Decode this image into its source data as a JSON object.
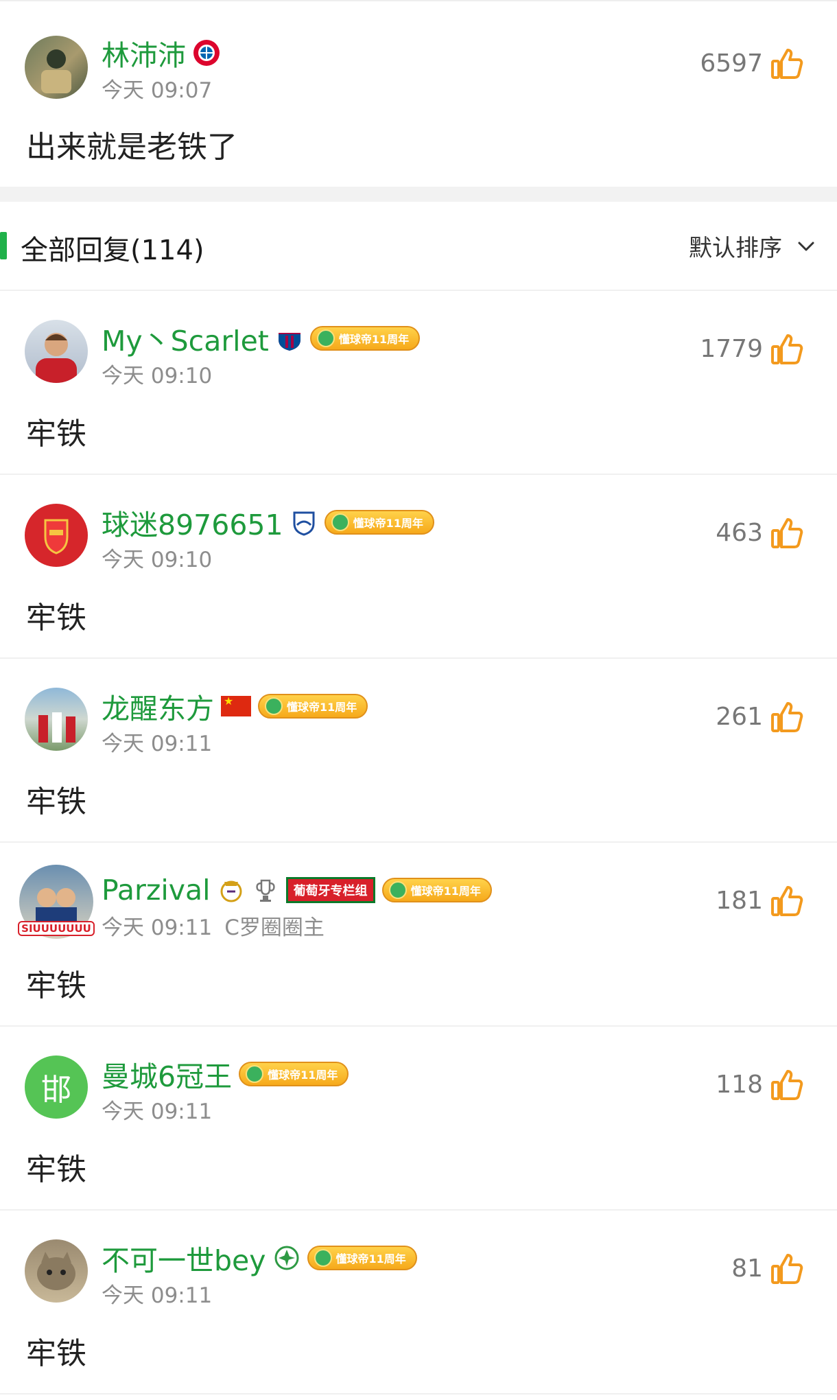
{
  "top_comment": {
    "username": "林沛沛",
    "time": "今天 09:07",
    "likes": "6597",
    "content": "出来就是老铁了"
  },
  "replies_header": {
    "title": "全部回复(114)",
    "sort_label": "默认排序"
  },
  "replies": [
    {
      "username": "My丶Scarlet",
      "time": "今天 09:10",
      "extra": "",
      "likes": "1779",
      "content": "牢铁",
      "badge": "懂球帝11周年"
    },
    {
      "username": "球迷8976651",
      "time": "今天 09:10",
      "extra": "",
      "likes": "463",
      "content": "牢铁",
      "badge": "懂球帝11周年"
    },
    {
      "username": "龙醒东方",
      "time": "今天 09:11",
      "extra": "",
      "likes": "261",
      "content": "牢铁",
      "badge": "懂球帝11周年"
    },
    {
      "username": "Parzival",
      "time": "今天 09:11",
      "extra": "C罗圈圈主",
      "likes": "181",
      "content": "牢铁",
      "badge": "懂球帝11周年",
      "group_badge": "葡萄牙专栏组",
      "avatar_caption": "SIUUUUUUU"
    },
    {
      "username": "曼城6冠王",
      "time": "今天 09:11",
      "extra": "",
      "likes": "118",
      "content": "牢铁",
      "badge": "懂球帝11周年",
      "avatar_text": "邯"
    },
    {
      "username": "不可一世bey",
      "time": "今天 09:11",
      "extra": "",
      "likes": "81",
      "content": "牢铁",
      "badge": "懂球帝11周年"
    }
  ],
  "colors": {
    "username": "#1e9a3c",
    "accent_bar": "#20b14a",
    "thumb": "#f39a1e"
  }
}
